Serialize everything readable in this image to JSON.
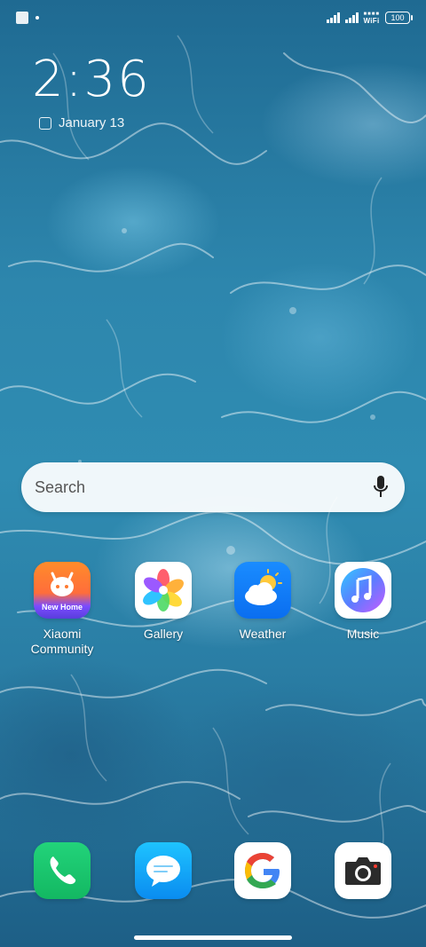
{
  "status_bar": {
    "battery_level": "100",
    "network_label": "WiFi"
  },
  "lock_info": {
    "time": "2:36",
    "date": "January 13"
  },
  "search": {
    "placeholder": "Search"
  },
  "apps": [
    {
      "label": "Xiaomi\nCommunity",
      "badge": "New Home",
      "icon": "xiaomi-community-icon"
    },
    {
      "label": "Gallery",
      "icon": "gallery-icon"
    },
    {
      "label": "Weather",
      "icon": "weather-icon"
    },
    {
      "label": "Music",
      "icon": "music-icon"
    }
  ],
  "dock": [
    {
      "icon": "phone-icon"
    },
    {
      "icon": "messages-icon"
    },
    {
      "icon": "google-icon"
    },
    {
      "icon": "camera-icon"
    }
  ],
  "colors": {
    "ocean_base": "#2a7ea5",
    "phone_green": "#19c66e",
    "messages_blue": "#12a8f8",
    "weather_blue": "#1a8cff"
  }
}
